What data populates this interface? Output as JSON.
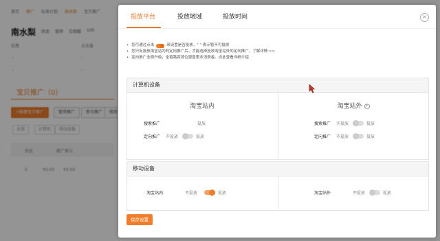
{
  "background": {
    "breadcrumb": [
      "首页",
      "推广",
      "标准计划",
      "南水梨",
      "宝贝推广"
    ],
    "plan_name": "南水梨",
    "plan_meta": [
      "状态",
      "暂停",
      "日限额",
      "100"
    ],
    "labels": [
      "花费",
      "点击量"
    ],
    "dashes": [
      "-",
      "-",
      "-",
      "-"
    ],
    "section_title": "宝贝推广（0）",
    "buttons": [
      "+新建宝贝推广",
      "暂停推广",
      "参与推广",
      "修改"
    ],
    "chips": [
      "全部",
      "计算机",
      "移动设备"
    ],
    "table_headers": [
      "状态",
      "推广单元"
    ],
    "table_cells": [
      "0",
      "¥0.00",
      "¥0.00"
    ]
  },
  "modal": {
    "tabs": [
      {
        "label": "投放平台",
        "active": true
      },
      {
        "label": "投放地域",
        "active": false
      },
      {
        "label": "投放时间",
        "active": false
      }
    ],
    "close_glyph": "×",
    "notes": [
      {
        "pre": "您可通过点击",
        "post": "来设置是否投放，\"  \" 表示暂不可投放"
      },
      {
        "pre": "",
        "post": "您只有投放淘宝站内的定向推广后，才能选择投放淘宝站外的定向推广，了解详情 >>"
      },
      {
        "pre": "",
        "post": "定向推广全面升级，全链路资源位更普惠本消费者。点此查看详细介绍"
      }
    ],
    "pc_section": {
      "title": "计算机设备",
      "left": {
        "title": "淘宝站内",
        "rows": [
          {
            "label": "搜索推广",
            "off": "",
            "on": "投放",
            "state": "static"
          },
          {
            "label": "定向推广",
            "off": "不投放",
            "on": "投放",
            "state": "off"
          }
        ]
      },
      "right": {
        "title": "淘宝站外",
        "rows": [
          {
            "label": "搜索推广",
            "off": "不投放",
            "on": "投放",
            "state": "off"
          },
          {
            "label": "定向推广",
            "off": "不投放",
            "on": "投放",
            "state": "off"
          }
        ]
      }
    },
    "mobile_section": {
      "title": "移动设备",
      "left": {
        "label": "淘宝站内",
        "off": "不投放",
        "on": "投放",
        "state": "on"
      },
      "right": {
        "label": "淘宝站外",
        "off": "不投放",
        "on": "投放",
        "state": "off"
      }
    },
    "save_label": "保存设置"
  },
  "colors": {
    "accent": "#f07d2a",
    "panel_head": "#f5f5f5"
  }
}
